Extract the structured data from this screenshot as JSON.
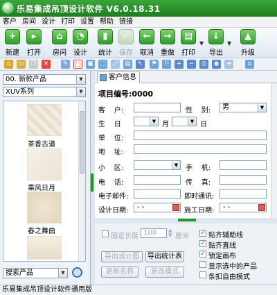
{
  "window": {
    "title": "乐易集成吊顶设计软件 V6.0.18.31"
  },
  "menu": [
    "客户",
    "房间",
    "设计",
    "打印",
    "设置",
    "帮助",
    "链接"
  ],
  "toolbar": {
    "new": "新建",
    "open": "打开",
    "room": "房间",
    "design": "设计",
    "stats": "统计",
    "save": "保存",
    "cancel": "取消",
    "redo": "重做",
    "print": "打印",
    "export": "导出",
    "upgrade": "升级"
  },
  "left": {
    "product_select": "00. 新款产品",
    "series_select": "XUV系列",
    "thumbs": [
      "茶香古道",
      "乘风日月",
      "春之舞曲"
    ],
    "search_select": "搜索产品"
  },
  "tab": {
    "label": "客户信息"
  },
  "form": {
    "project_no": "项目编号:0000",
    "customer_label": "客    户:",
    "gender_label": "性    别:",
    "gender_value": "男",
    "birthday_label": "生    日",
    "month_label": "月",
    "day_label": "日",
    "company_label": "单    位:",
    "address_label": "地    址:",
    "district_label": "小    区:",
    "mobile_label": "手    机:",
    "phone_label": "电    话:",
    "fax_label": "传    真:",
    "email_label": "电子邮件:",
    "im_label": "即时通讯:",
    "design_date_label": "设计日期:",
    "construct_date_label": "施工日期:",
    "date_placeholder": "-  -"
  },
  "bottom": {
    "fixed_length": "固定长度",
    "length_value": "100",
    "unit": "厘米",
    "export_design": "导出设计图",
    "export_stats": "导出统计表",
    "update_name": "更新名称",
    "change_mode": "更改模式",
    "options": [
      "贴齐辅助线",
      "贴齐直线",
      "锁定画布",
      "显示选中的产品",
      "条扣自由模式"
    ]
  },
  "status": {
    "text": "乐易集成吊顶设计软件通用版"
  }
}
